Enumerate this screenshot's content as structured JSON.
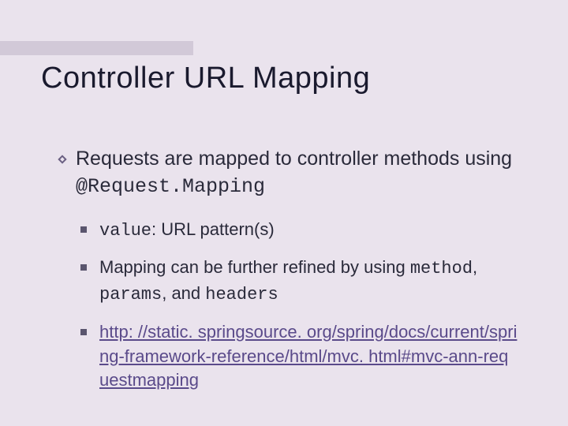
{
  "slide": {
    "title": "Controller URL Mapping",
    "bullet": {
      "text_pre": "Requests are mapped to controller methods using ",
      "code": "@Request.Mapping"
    },
    "subs": [
      {
        "code": "value",
        "text": ": URL pattern(s)"
      },
      {
        "text_pre": "Mapping can be further refined by using ",
        "code1": "method",
        "sep1": ", ",
        "code2": "params",
        "sep2": ", and ",
        "code3": "headers"
      },
      {
        "link": "http: //static. springsource. org/spring/docs/current/spring-framework-reference/html/mvc. html#mvc-ann-requestmapping"
      }
    ]
  }
}
